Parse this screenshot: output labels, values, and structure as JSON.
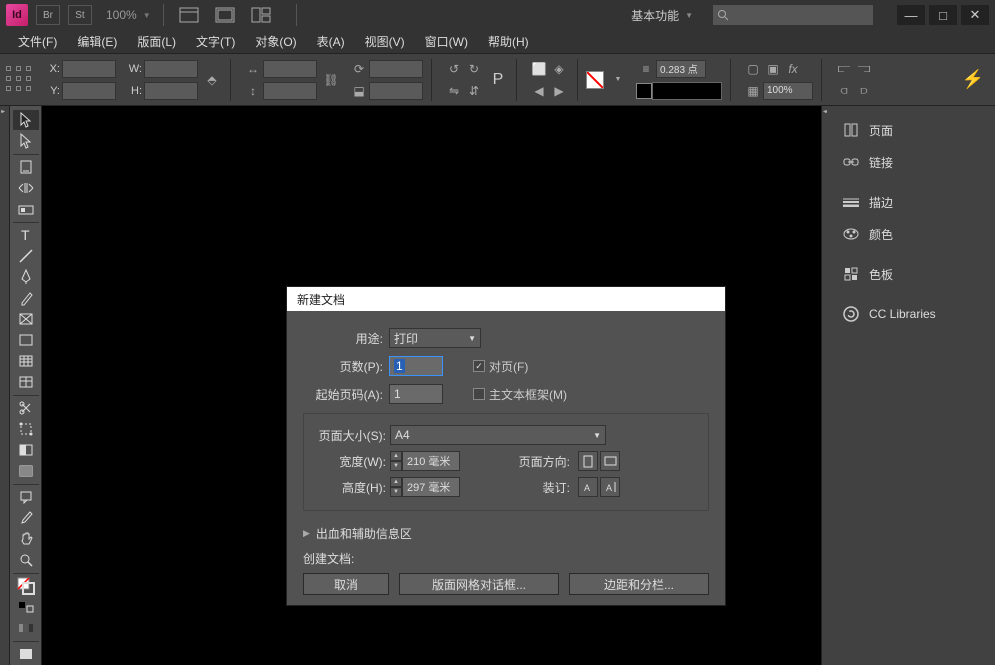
{
  "titlebar": {
    "br": "Br",
    "st": "St",
    "zoom": "100%",
    "workspace": "基本功能"
  },
  "menu": {
    "file": "文件(F)",
    "edit": "编辑(E)",
    "layout": "版面(L)",
    "type": "文字(T)",
    "object": "对象(O)",
    "table": "表(A)",
    "view": "视图(V)",
    "window": "窗口(W)",
    "help": "帮助(H)"
  },
  "control": {
    "x": "X:",
    "y": "Y:",
    "w": "W:",
    "h": "H:",
    "stroke_val": "0.283 点",
    "opacity": "100%"
  },
  "panels": {
    "pages": "页面",
    "links": "链接",
    "stroke": "描边",
    "color": "颜色",
    "swatches": "色板",
    "cclib": "CC Libraries"
  },
  "dialog": {
    "title": "新建文档",
    "intent_label": "用途:",
    "intent_value": "打印",
    "pages_label": "页数(P):",
    "pages_value": "1",
    "facing_label": "对页(F)",
    "start_label": "起始页码(A):",
    "start_value": "1",
    "textframe_label": "主文本框架(M)",
    "size_label": "页面大小(S):",
    "size_value": "A4",
    "width_label": "宽度(W):",
    "width_value": "210 毫米",
    "height_label": "高度(H):",
    "height_value": "297 毫米",
    "orient_label": "页面方向:",
    "bind_label": "装订:",
    "bleed_section": "出血和辅助信息区",
    "create_label": "创建文档:",
    "cancel": "取消",
    "layout_grid": "版面网格对话框...",
    "margins": "边距和分栏..."
  }
}
